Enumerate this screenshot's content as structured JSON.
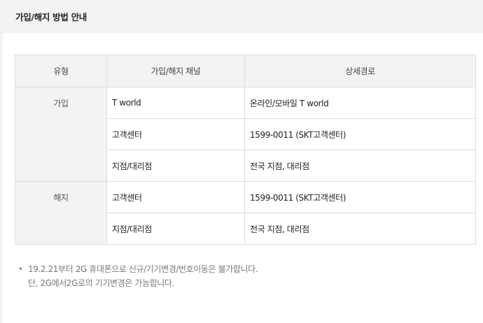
{
  "header": {
    "title": "가입/해지 방법 안내"
  },
  "table": {
    "columns": [
      "유형",
      "가입/해지 채널",
      "상세경로"
    ],
    "groups": [
      {
        "type": "가입",
        "rows": [
          {
            "channel": "T world",
            "detail": "온라인/모바일 T world"
          },
          {
            "channel": "고객센터",
            "detail": "1599-0011 (SKT고객센터)"
          },
          {
            "channel": "지점/대리점",
            "detail": "전국 지점, 대리점"
          }
        ]
      },
      {
        "type": "해지",
        "rows": [
          {
            "channel": "고객센터",
            "detail": "1599-0011 (SKT고객센터)"
          },
          {
            "channel": "지점/대리점",
            "detail": "전국 지점, 대리점"
          }
        ]
      }
    ]
  },
  "notes": {
    "bullet": "•",
    "lines": [
      "19.2.21부터 2G 휴대폰으로 신규/기기변경/번호이동은 불가합니다.",
      "단, 2G에서2G로의 기기변경은 가능합니다."
    ]
  }
}
